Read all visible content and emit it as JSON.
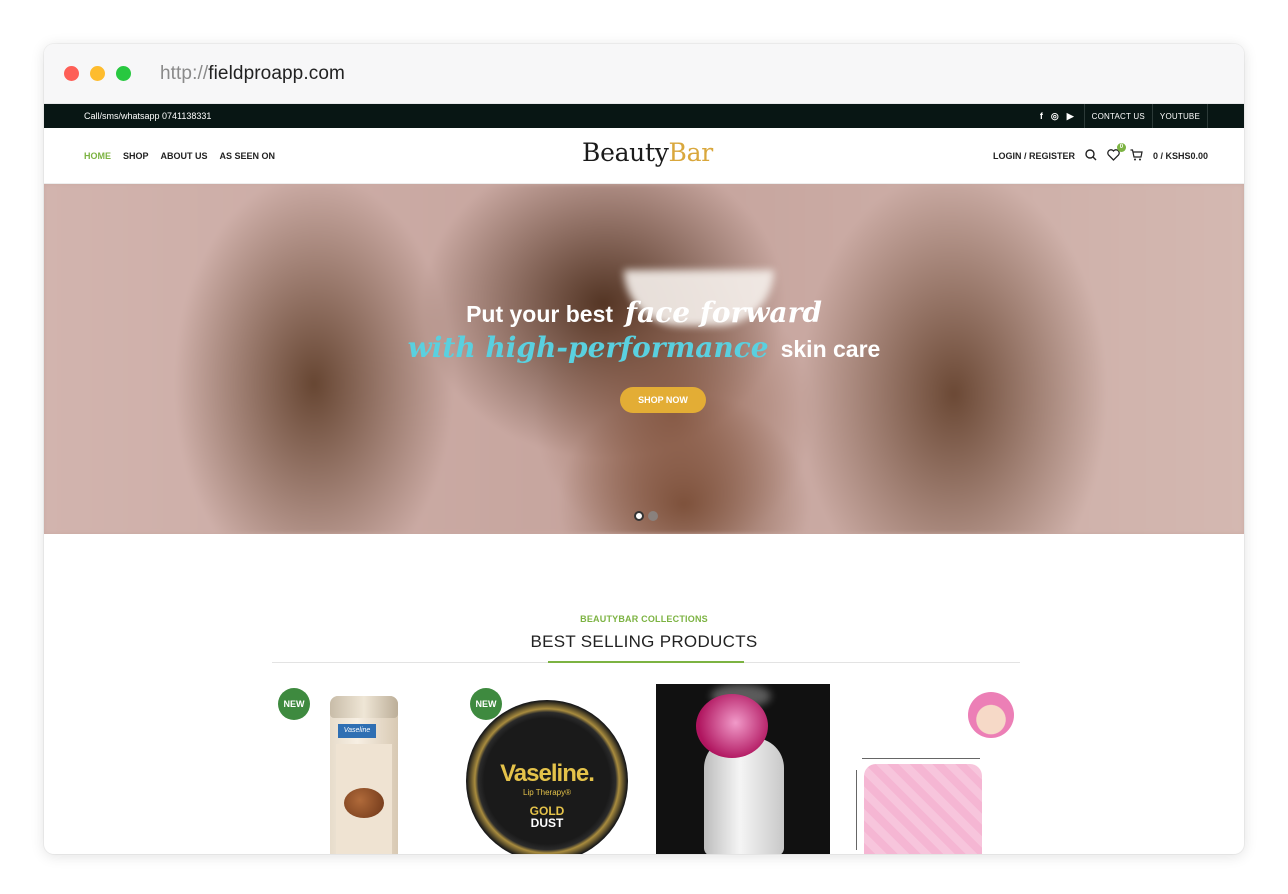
{
  "browser": {
    "url_proto": "http://",
    "url_domain": "fieldproapp.com"
  },
  "topbar": {
    "contact": "Call/sms/whatsapp 0741138331",
    "social_icons": [
      "facebook-icon",
      "instagram-icon",
      "youtube-icon"
    ],
    "links": [
      "CONTACT US",
      "YOUTUBE"
    ]
  },
  "header": {
    "nav": [
      "HOME",
      "SHOP",
      "ABOUT US",
      "AS SEEN ON"
    ],
    "logo_part1": "Beauty",
    "logo_part2": "Bar",
    "login": "LOGIN / REGISTER",
    "wishlist_count": "0",
    "cart": "0 / KSHS0.00"
  },
  "hero": {
    "line1_plain": "Put your best",
    "line1_italic": "face forward",
    "line2_italic": "with high-performance",
    "line2_plain": "skin care",
    "button": "SHOP NOW",
    "slides_total": 2,
    "active_slide": 1
  },
  "collections": {
    "eyebrow": "BEAUTYBAR COLLECTIONS",
    "title": "BEST SELLING PRODUCTS"
  },
  "products": [
    {
      "badge": "NEW",
      "brand": "Vaseline"
    },
    {
      "badge": "NEW",
      "brand": "Vaseline.",
      "sub": "Lip Therapy®",
      "gold": "GOLD",
      "dust": "DUST"
    },
    {
      "badge": ""
    },
    {
      "badge": ""
    }
  ],
  "colors": {
    "accent_green": "#7cb342",
    "topbar": "#081614",
    "shop_button": "#e3ad35",
    "hero_italic": "#5ad0df"
  }
}
